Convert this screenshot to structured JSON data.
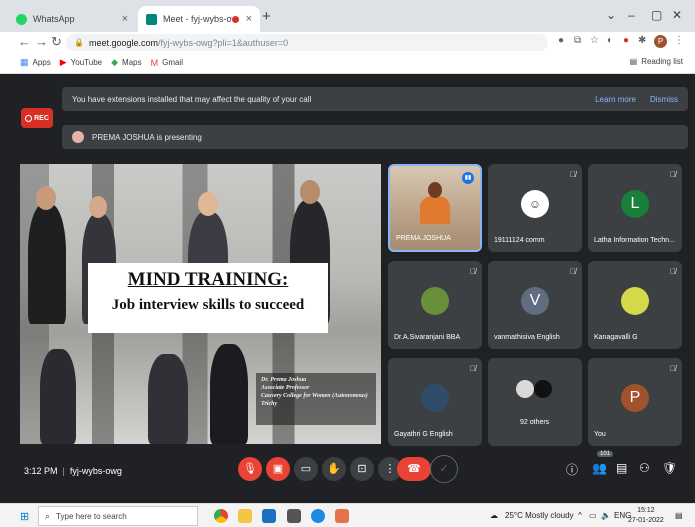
{
  "browser": {
    "tabs": [
      {
        "title": "WhatsApp",
        "active": false,
        "favicon_color": "#25d366"
      },
      {
        "title": "Meet - fyj-wybs-owg",
        "active": true,
        "favicon_color": "#00897b",
        "recording": true
      }
    ],
    "url_host": "meet.google.com",
    "url_path": "/fyj-wybs-owg?pli=1&authuser=0",
    "bookmarks": [
      {
        "label": "Apps",
        "icon": "apps-grid-icon"
      },
      {
        "label": "YouTube",
        "icon": "youtube-icon"
      },
      {
        "label": "Maps",
        "icon": "maps-icon"
      },
      {
        "label": "Gmail",
        "icon": "gmail-icon"
      }
    ],
    "reading_list": "Reading list",
    "profile_initial": "P"
  },
  "meet": {
    "extension_banner": "You have extensions installed that may affect the quality of your call",
    "learn_more": "Learn more",
    "dismiss": "Dismiss",
    "rec_label": "REC",
    "presenting_text": "PREMA JOSHUA is presenting",
    "slide": {
      "title": "MIND TRAINING:",
      "subtitle": "Job interview skills to succeed",
      "credit_lines": [
        "Dr. Prema Joshua",
        "Associate Professor",
        "Cauvery College for Women (Autonomous)",
        "Trichy"
      ]
    },
    "participants": [
      {
        "name": "PREMA JOSHUA",
        "type": "video"
      },
      {
        "name": "19111124 comm",
        "type": "photo",
        "avatar_color": "#ffffff"
      },
      {
        "name": "Latha Information Techn...",
        "type": "initial",
        "initial": "L",
        "avatar_color": "#188038"
      },
      {
        "name": "Dr.A.Sivaranjani BBA",
        "type": "photo",
        "avatar_color": "#6a8f3a"
      },
      {
        "name": "vanmathisiva English",
        "type": "initial",
        "initial": "V",
        "avatar_color": "#5f6d7e"
      },
      {
        "name": "Kanagavalli G",
        "type": "photo",
        "avatar_color": "#d4d94a"
      },
      {
        "name": "Gayathri G English",
        "type": "photo",
        "avatar_color": "#2f4c6a"
      },
      {
        "name": "92 others",
        "type": "group",
        "avatar_color": "#ffffff"
      },
      {
        "name": "You",
        "type": "initial",
        "initial": "P",
        "avatar_color": "#a0522d"
      }
    ],
    "meeting_time": "3:12 PM",
    "meeting_code": "fyj-wybs-owg",
    "participant_count": "101"
  },
  "taskbar": {
    "search_placeholder": "Type here to search",
    "weather": "25°C  Mostly cloudy",
    "language": "ENG",
    "time": "15:12",
    "date": "27-01-2022"
  }
}
